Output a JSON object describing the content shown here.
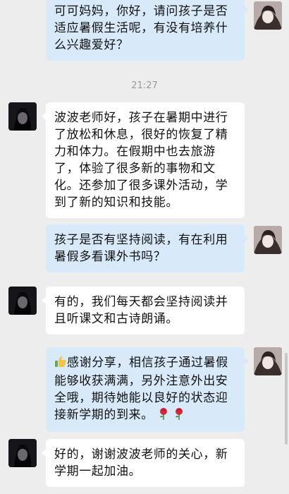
{
  "timestamp": "21:27",
  "colors": {
    "background": "#ededed",
    "incoming_bubble": "#ffffff",
    "outgoing_bubble": "#d8eafa",
    "timestamp_text": "#9a9a9a"
  },
  "messages": [
    {
      "side": "out",
      "avatar": "parent-avatar",
      "text": "可可妈妈，你好，请问孩子是否适应暑假生活呢，有没有培养什么兴趣爱好？"
    },
    {
      "side": "in",
      "avatar": "teacher-avatar",
      "text": "波波老师好，孩子在暑期中进行了放松和休息，很好的恢复了精力和体力。在假期中也去旅游了，体验了很多新的事物和文化。还参加了很多课外活动，学到了新的知识和技能。"
    },
    {
      "side": "out",
      "avatar": "parent-avatar",
      "text": "孩子是否有坚持阅读，有在利用暑假多看课外书吗？"
    },
    {
      "side": "in",
      "avatar": "teacher-avatar",
      "text": "有的，我们每天都会坚持阅读并且听课文和古诗朗诵。"
    },
    {
      "side": "out",
      "avatar": "parent-avatar",
      "emoji_prefix": "thumbs-up-emoji",
      "text": "感谢分享，相信孩子通过暑假能够收获满满，另外注意外出安全哦，期待她能以良好的状态迎接新学期的到来。",
      "emoji_suffix": [
        "rose-emoji",
        "rose-emoji"
      ]
    },
    {
      "side": "in",
      "avatar": "teacher-avatar",
      "text": "好的，谢谢波波老师的关心，新学期一起加油。"
    }
  ]
}
